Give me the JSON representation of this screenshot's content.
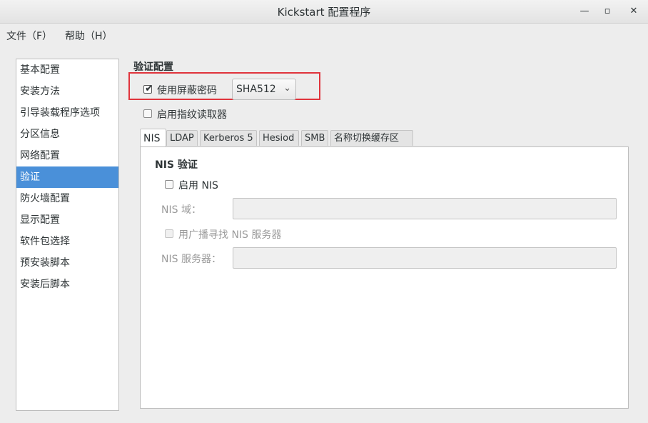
{
  "window": {
    "title": "Kickstart 配置程序",
    "minimize_glyph": "—",
    "maximize_glyph": "▫",
    "close_glyph": "✕"
  },
  "menubar": {
    "items": [
      {
        "label": "文件（F）"
      },
      {
        "label": "帮助（H）"
      }
    ]
  },
  "sidebar": {
    "items": [
      {
        "label": "基本配置"
      },
      {
        "label": "安装方法"
      },
      {
        "label": "引导装载程序选项"
      },
      {
        "label": "分区信息"
      },
      {
        "label": "网络配置"
      },
      {
        "label": "验证",
        "selected": true
      },
      {
        "label": "防火墙配置"
      },
      {
        "label": "显示配置"
      },
      {
        "label": "软件包选择"
      },
      {
        "label": "预安装脚本"
      },
      {
        "label": "安装后脚本"
      }
    ]
  },
  "auth": {
    "section_title": "验证配置",
    "shadow_password": {
      "label": "使用屏蔽密码",
      "checked": true
    },
    "hash_select": {
      "value": "SHA512"
    },
    "fingerprint": {
      "label": "启用指纹读取器",
      "checked": false
    }
  },
  "tabs": [
    {
      "label": "NIS",
      "active": true
    },
    {
      "label": "LDAP"
    },
    {
      "label": "Kerberos 5"
    },
    {
      "label": "Hesiod"
    },
    {
      "label": "SMB"
    },
    {
      "label": "名称切换缓存区"
    }
  ],
  "nis": {
    "title": "NIS 验证",
    "enable": {
      "label": "启用  NIS",
      "checked": false
    },
    "domain_label": "NIS 域：",
    "domain_value": "",
    "broadcast": {
      "label": "用广播寻找  NIS 服务器",
      "checked": false
    },
    "server_label": "NIS 服务器：",
    "server_value": ""
  },
  "colors": {
    "selection": "#4a90d9",
    "highlight_box": "#e0343c"
  }
}
